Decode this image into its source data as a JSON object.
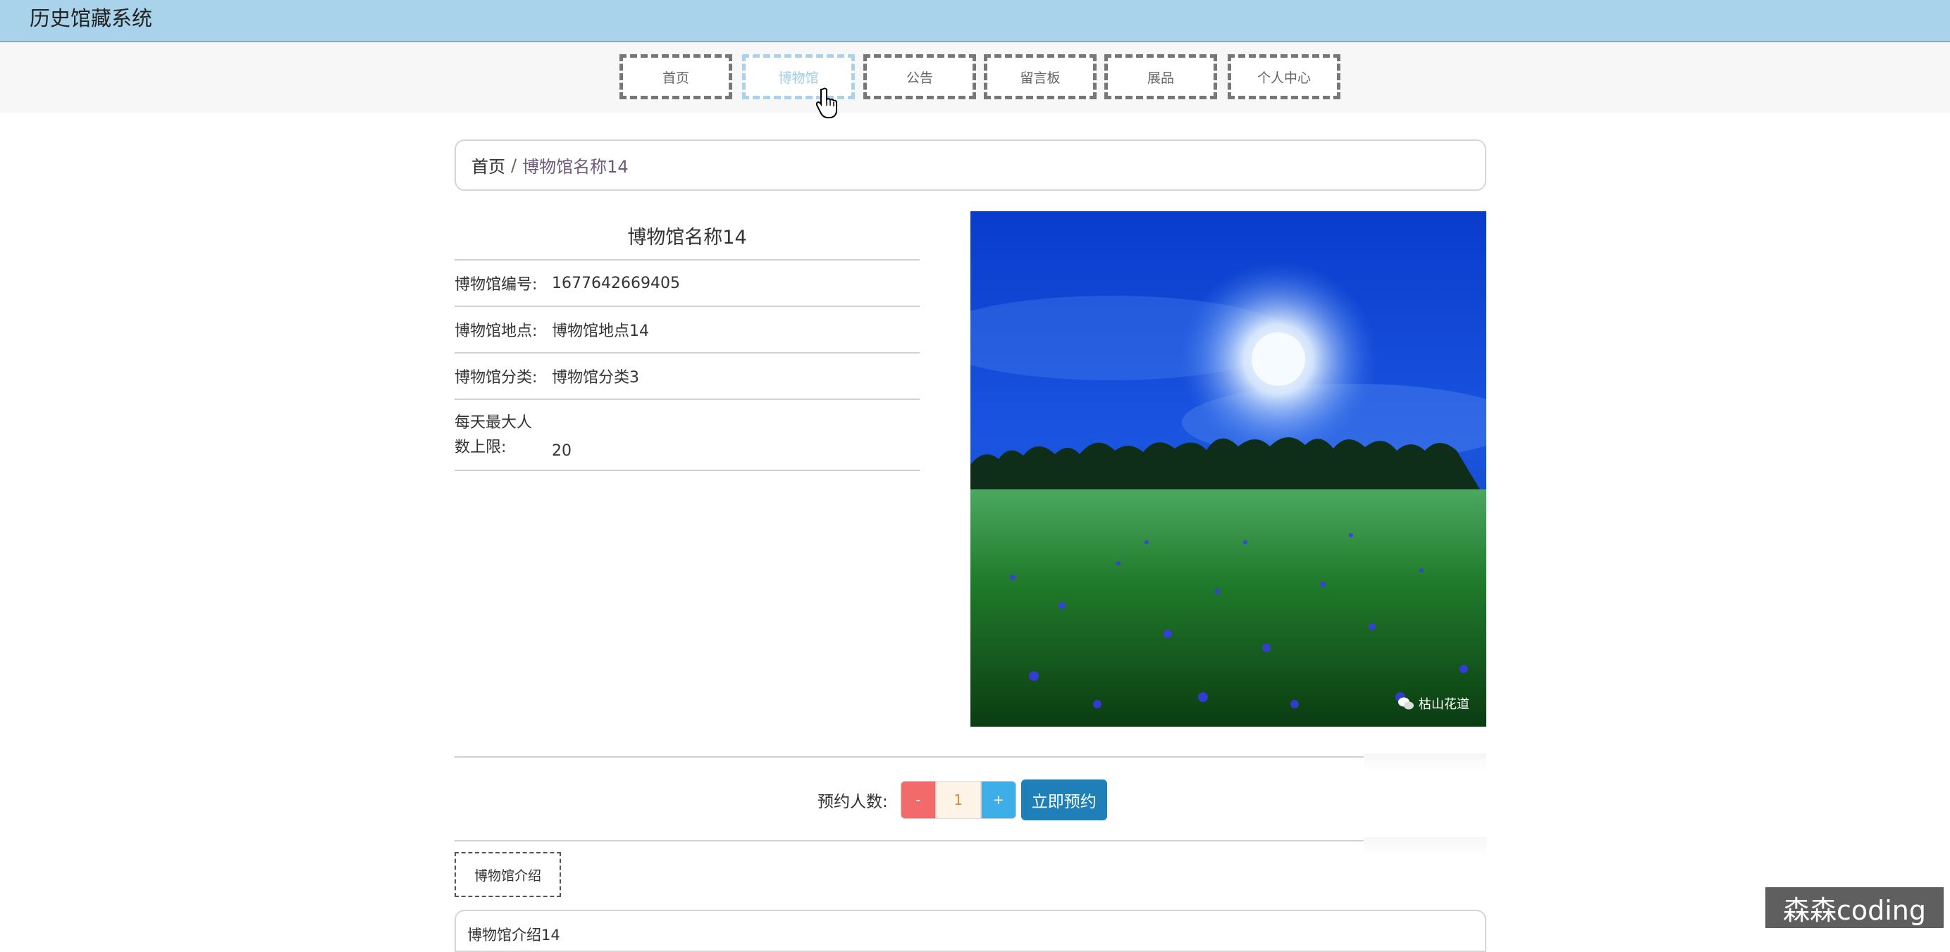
{
  "app": {
    "title": "历史馆藏系统"
  },
  "nav": {
    "items": [
      {
        "label": "首页",
        "active": false
      },
      {
        "label": "博物馆",
        "active": true
      },
      {
        "label": "公告",
        "active": false
      },
      {
        "label": "留言板",
        "active": false
      },
      {
        "label": "展品",
        "active": false
      },
      {
        "label": "个人中心",
        "active": false
      }
    ]
  },
  "breadcrumb": {
    "home": "首页",
    "separator": "/",
    "current": "博物馆名称14"
  },
  "museum": {
    "name": "博物馆名称14",
    "fields": [
      {
        "label": "博物馆编号:",
        "value": "1677642669405"
      },
      {
        "label": "博物馆地点:",
        "value": "博物馆地点14"
      },
      {
        "label": "博物馆分类:",
        "value": "博物馆分类3"
      }
    ],
    "max_visitors": {
      "label_line1": "每天最大人",
      "label_line2": "数上限:",
      "value": "20"
    },
    "photo_credit": "枯山花道"
  },
  "booking": {
    "label": "预约人数:",
    "minus": "-",
    "quantity": "1",
    "plus": "+",
    "submit": "立即预约"
  },
  "tabs": {
    "intro": "博物馆介绍"
  },
  "intro": {
    "text": "博物馆介绍14"
  },
  "watermark": "森森coding",
  "colors": {
    "topbar": "#a9d3ea",
    "nav_active": "#a9d3ea",
    "minus_button": "#f26a6a",
    "plus_button": "#3eaee8",
    "book_button": "#1f7fb8"
  }
}
